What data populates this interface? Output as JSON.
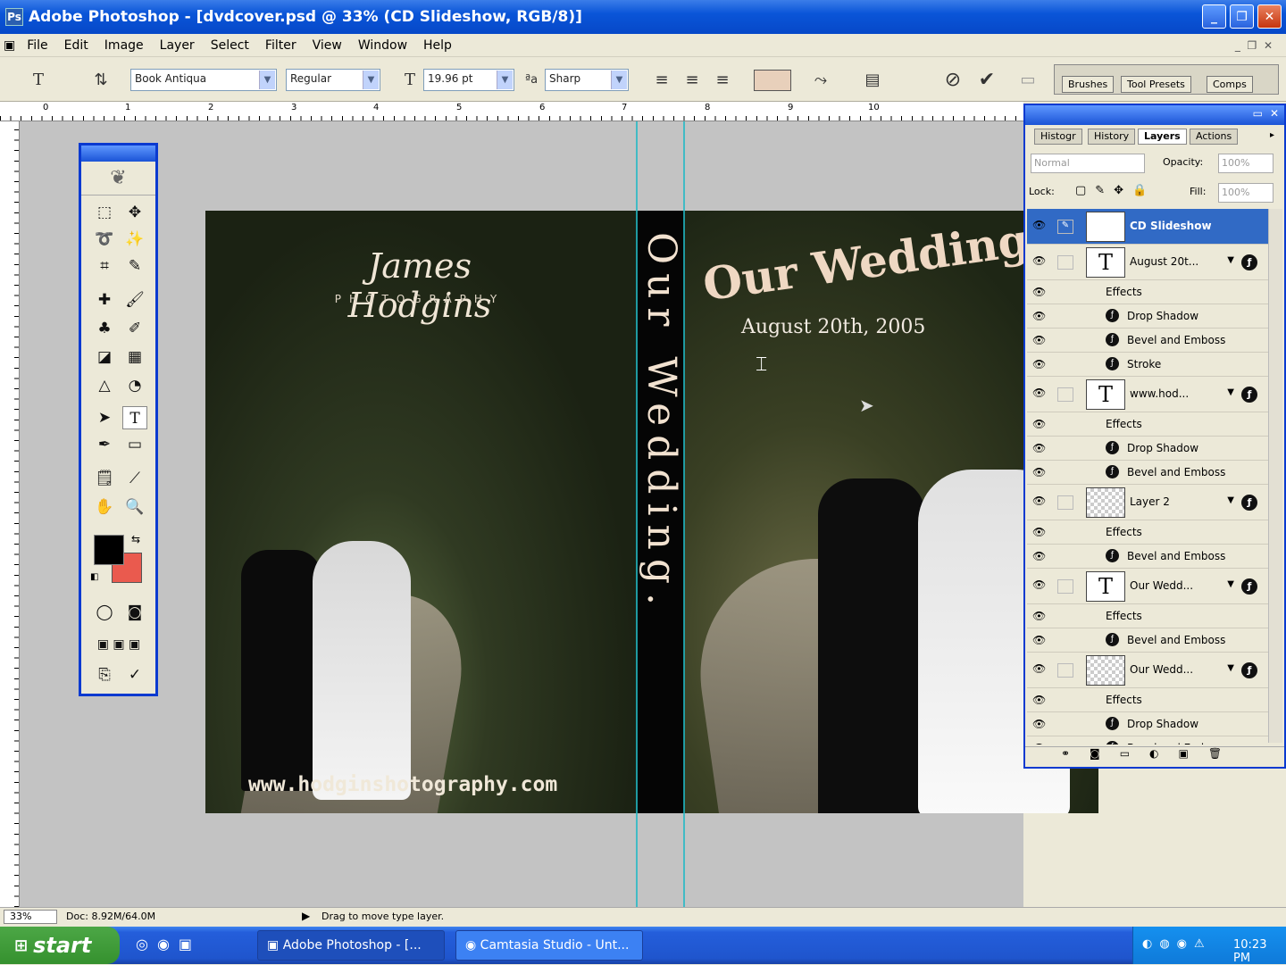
{
  "window": {
    "title": "Adobe Photoshop - [dvdcover.psd @ 33% (CD Slideshow, RGB/8)]"
  },
  "menu": [
    "File",
    "Edit",
    "Image",
    "Layer",
    "Select",
    "Filter",
    "View",
    "Window",
    "Help"
  ],
  "options": {
    "font_family": "Book Antiqua",
    "font_style": "Regular",
    "font_size": "19.96 pt",
    "antialias": "Sharp",
    "wells": [
      "Brushes",
      "Tool Presets",
      "Comps"
    ]
  },
  "ruler_labels": [
    "0",
    "1",
    "2",
    "3",
    "4",
    "5",
    "6",
    "7",
    "8",
    "9",
    "10"
  ],
  "canvas": {
    "studio_name": "James Hodgins",
    "studio_sub": "PHOTOGRAPHY",
    "website": "www.hodginshotography.com",
    "spine_text": "Our Wedding.",
    "front_title": "Our Wedding",
    "front_date": "August 20th, 2005"
  },
  "layers_panel": {
    "tabs": [
      "Histogr",
      "History",
      "Layers",
      "Actions"
    ],
    "blend_mode": "Normal",
    "opacity_label": "Opacity:",
    "opacity_value": "100%",
    "lock_label": "Lock:",
    "fill_label": "Fill:",
    "fill_value": "100%",
    "rows": [
      {
        "type": "text",
        "name": "CD Slideshow",
        "selected": true
      },
      {
        "type": "text",
        "name": "August 20t..."
      },
      {
        "type": "effects",
        "name": "Effects"
      },
      {
        "type": "effect",
        "name": "Drop Shadow"
      },
      {
        "type": "effect",
        "name": "Bevel and Emboss"
      },
      {
        "type": "effect",
        "name": "Stroke"
      },
      {
        "type": "text",
        "name": "www.hod..."
      },
      {
        "type": "effects",
        "name": "Effects"
      },
      {
        "type": "effect",
        "name": "Drop Shadow"
      },
      {
        "type": "effect",
        "name": "Bevel and Emboss"
      },
      {
        "type": "raster",
        "name": "Layer 2"
      },
      {
        "type": "effects",
        "name": "Effects"
      },
      {
        "type": "effect",
        "name": "Bevel and Emboss"
      },
      {
        "type": "text",
        "name": "Our Wedd..."
      },
      {
        "type": "effects",
        "name": "Effects"
      },
      {
        "type": "effect",
        "name": "Bevel and Emboss"
      },
      {
        "type": "raster",
        "name": "Our Wedd..."
      },
      {
        "type": "effects",
        "name": "Effects"
      },
      {
        "type": "effect",
        "name": "Drop Shadow"
      },
      {
        "type": "effect",
        "name": "Bevel and Emboss"
      }
    ]
  },
  "status": {
    "zoom": "33%",
    "doc": "Doc: 8.92M/64.0M",
    "hint": "Drag to move type layer."
  },
  "taskbar": {
    "start": "start",
    "tasks": [
      "Adobe Photoshop - [...",
      "Camtasia Studio - Unt..."
    ],
    "clock": "10:23 PM"
  },
  "colors": {
    "titlebar": "#0a55d8",
    "foreground": "#000000",
    "background": "#ea5a4e",
    "selection": "#316ac5"
  }
}
